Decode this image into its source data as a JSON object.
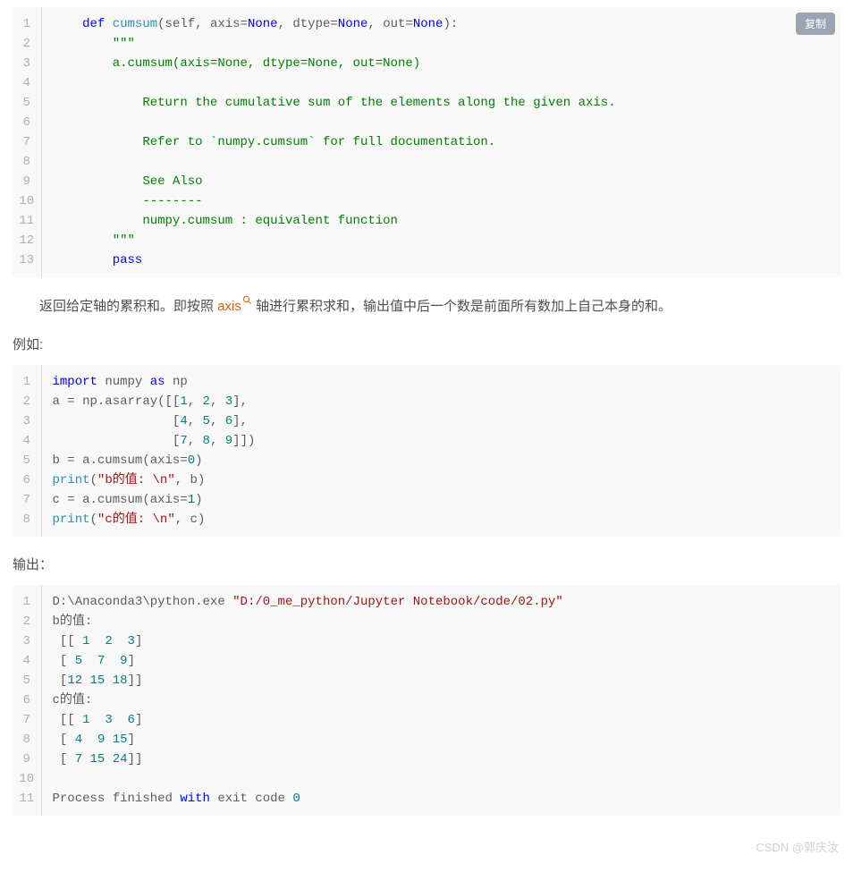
{
  "copy_label": "复制",
  "code1": {
    "lines": [
      [
        {
          "t": "    "
        },
        {
          "t": "def ",
          "c": "kw"
        },
        {
          "t": "cumsum",
          "c": "fn"
        },
        {
          "t": "("
        },
        {
          "t": "self"
        },
        {
          "t": ", axis="
        },
        {
          "t": "None",
          "c": "bi"
        },
        {
          "t": ", dtype="
        },
        {
          "t": "None",
          "c": "bi"
        },
        {
          "t": ", out="
        },
        {
          "t": "None",
          "c": "bi"
        },
        {
          "t": "):"
        }
      ],
      [
        {
          "t": "        "
        },
        {
          "t": "\"\"\"",
          "c": "cm"
        }
      ],
      [
        {
          "t": "        a.cumsum(axis=None, dtype=None, out=None)",
          "c": "cm"
        }
      ],
      [
        {
          "t": ""
        }
      ],
      [
        {
          "t": "            Return the cumulative sum of the elements along the given axis.",
          "c": "cm"
        }
      ],
      [
        {
          "t": ""
        }
      ],
      [
        {
          "t": "            Refer to `numpy.cumsum` for full documentation.",
          "c": "cm"
        }
      ],
      [
        {
          "t": ""
        }
      ],
      [
        {
          "t": "            See Also",
          "c": "cm"
        }
      ],
      [
        {
          "t": "            --------",
          "c": "cm"
        }
      ],
      [
        {
          "t": "            numpy.cumsum : equivalent function",
          "c": "cm"
        }
      ],
      [
        {
          "t": "        "
        },
        {
          "t": "\"\"\"",
          "c": "cm"
        }
      ],
      [
        {
          "t": "        "
        },
        {
          "t": "pass",
          "c": "kw"
        }
      ]
    ]
  },
  "para1_before": "返回给定轴的累积和。即按照 ",
  "para1_link": "axis",
  "para1_after": " 轴进行累积求和，输出值中后一个数是前面所有数加上自己本身的和。",
  "heading1": "例如:",
  "code2": {
    "lines": [
      [
        {
          "t": "import",
          "c": "kw"
        },
        {
          "t": " numpy "
        },
        {
          "t": "as",
          "c": "kw"
        },
        {
          "t": " np"
        }
      ],
      [
        {
          "t": "a = np.asarray([["
        },
        {
          "t": "1",
          "c": "nm"
        },
        {
          "t": ", "
        },
        {
          "t": "2",
          "c": "nm"
        },
        {
          "t": ", "
        },
        {
          "t": "3",
          "c": "nm"
        },
        {
          "t": "],"
        }
      ],
      [
        {
          "t": "                ["
        },
        {
          "t": "4",
          "c": "nm"
        },
        {
          "t": ", "
        },
        {
          "t": "5",
          "c": "nm"
        },
        {
          "t": ", "
        },
        {
          "t": "6",
          "c": "nm"
        },
        {
          "t": "],"
        }
      ],
      [
        {
          "t": "                ["
        },
        {
          "t": "7",
          "c": "nm"
        },
        {
          "t": ", "
        },
        {
          "t": "8",
          "c": "nm"
        },
        {
          "t": ", "
        },
        {
          "t": "9",
          "c": "nm"
        },
        {
          "t": "]])"
        }
      ],
      [
        {
          "t": "b = a.cumsum(axis="
        },
        {
          "t": "0",
          "c": "nm"
        },
        {
          "t": ")"
        }
      ],
      [
        {
          "t": "print",
          "c": "fn"
        },
        {
          "t": "("
        },
        {
          "t": "\"b的值: \\n\"",
          "c": "str"
        },
        {
          "t": ", b)"
        }
      ],
      [
        {
          "t": "c = a.cumsum(axis="
        },
        {
          "t": "1",
          "c": "nm"
        },
        {
          "t": ")"
        }
      ],
      [
        {
          "t": "print",
          "c": "fn"
        },
        {
          "t": "("
        },
        {
          "t": "\"c的值: \\n\"",
          "c": "str"
        },
        {
          "t": ", c)"
        }
      ]
    ]
  },
  "heading2": "输出：",
  "code3": {
    "lines": [
      [
        {
          "t": "D:\\Anaconda3\\python.exe "
        },
        {
          "t": "\"D:/0_me_python/Jupyter Notebook/code/02.py\"",
          "c": "str"
        }
      ],
      [
        {
          "t": "b的值: "
        }
      ],
      [
        {
          "t": " [[ "
        },
        {
          "t": "1",
          "c": "nm"
        },
        {
          "t": "  "
        },
        {
          "t": "2",
          "c": "nm"
        },
        {
          "t": "  "
        },
        {
          "t": "3",
          "c": "nm"
        },
        {
          "t": "]"
        }
      ],
      [
        {
          "t": " [ "
        },
        {
          "t": "5",
          "c": "nm"
        },
        {
          "t": "  "
        },
        {
          "t": "7",
          "c": "nm"
        },
        {
          "t": "  "
        },
        {
          "t": "9",
          "c": "nm"
        },
        {
          "t": "]"
        }
      ],
      [
        {
          "t": " ["
        },
        {
          "t": "12",
          "c": "nm"
        },
        {
          "t": " "
        },
        {
          "t": "15",
          "c": "nm"
        },
        {
          "t": " "
        },
        {
          "t": "18",
          "c": "nm"
        },
        {
          "t": "]]"
        }
      ],
      [
        {
          "t": "c的值: "
        }
      ],
      [
        {
          "t": " [[ "
        },
        {
          "t": "1",
          "c": "nm"
        },
        {
          "t": "  "
        },
        {
          "t": "3",
          "c": "nm"
        },
        {
          "t": "  "
        },
        {
          "t": "6",
          "c": "nm"
        },
        {
          "t": "]"
        }
      ],
      [
        {
          "t": " [ "
        },
        {
          "t": "4",
          "c": "nm"
        },
        {
          "t": "  "
        },
        {
          "t": "9",
          "c": "nm"
        },
        {
          "t": " "
        },
        {
          "t": "15",
          "c": "nm"
        },
        {
          "t": "]"
        }
      ],
      [
        {
          "t": " [ "
        },
        {
          "t": "7",
          "c": "nm"
        },
        {
          "t": " "
        },
        {
          "t": "15",
          "c": "nm"
        },
        {
          "t": " "
        },
        {
          "t": "24",
          "c": "nm"
        },
        {
          "t": "]]"
        }
      ],
      [
        {
          "t": ""
        }
      ],
      [
        {
          "t": "Process finished "
        },
        {
          "t": "with",
          "c": "kw"
        },
        {
          "t": " exit code "
        },
        {
          "t": "0",
          "c": "nm"
        }
      ]
    ]
  },
  "watermark": "CSDN @郭庆汝"
}
